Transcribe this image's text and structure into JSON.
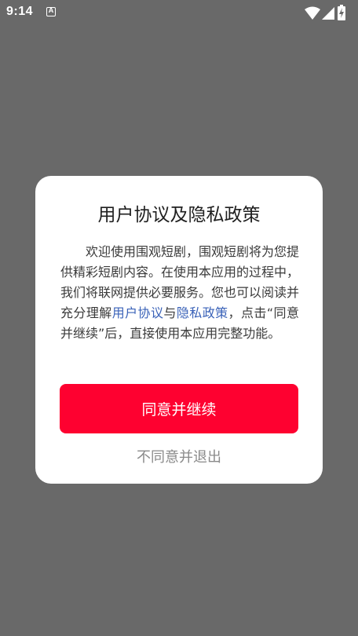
{
  "status_bar": {
    "time": "9:14",
    "notification_letter": "A",
    "icons": [
      "wifi-icon",
      "cellular-signal-icon",
      "battery-charging-icon"
    ]
  },
  "dialog": {
    "title": "用户协议及隐私政策",
    "body_part1": "欢迎使用围观短剧，围观短剧将为您提供精彩短剧内容。在使用本应用的过程中，我们将联网提供必要服务。您也可以阅读并充分理解",
    "link_user_agreement": "用户协议",
    "body_and": "与",
    "link_privacy_policy": "隐私政策",
    "body_part2": "，点击“同意并继续”后，直接使用本应用完整功能。",
    "agree_label": "同意并继续",
    "decline_label": "不同意并退出"
  },
  "colors": {
    "overlay": "#696969",
    "accent": "#fe0130",
    "link": "#3a62b8"
  }
}
